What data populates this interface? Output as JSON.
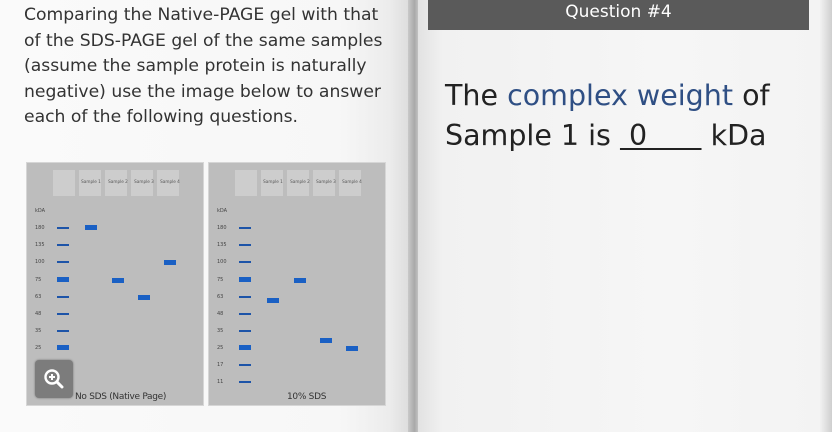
{
  "instructions": "Comparing the Native-PAGE gel with that of the SDS-PAGE gel of the same samples (assume the sample protein is naturally negative) use the image below to answer each of the following questions.",
  "question": {
    "header": "Question #4",
    "text_before": "The ",
    "highlight": "complex weight",
    "text_middle": " of Sample 1 is ",
    "answer_blank": " 0      ",
    "unit": " kDa"
  },
  "gels": [
    {
      "lanes": [
        "Sample 1",
        "Sample 2",
        "Sample 3",
        "Sample 4"
      ],
      "kda_label": "kDA",
      "ladder": [
        "180",
        "135",
        "100",
        "75",
        "63",
        "48",
        "35",
        "25",
        "17",
        "11"
      ],
      "caption": "No SDS (Native Page)"
    },
    {
      "lanes": [
        "Sample 1",
        "Sample 2",
        "Sample 3",
        "Sample 4"
      ],
      "kda_label": "kDA",
      "ladder": [
        "180",
        "135",
        "100",
        "75",
        "63",
        "48",
        "35",
        "25",
        "17",
        "11"
      ],
      "caption": "10% SDS"
    }
  ],
  "icons": {
    "zoom": "zoom-in-icon"
  },
  "colors": {
    "band": "#1a60c4",
    "highlight": "#2f4f84",
    "header_bg": "#5a5a5a"
  }
}
